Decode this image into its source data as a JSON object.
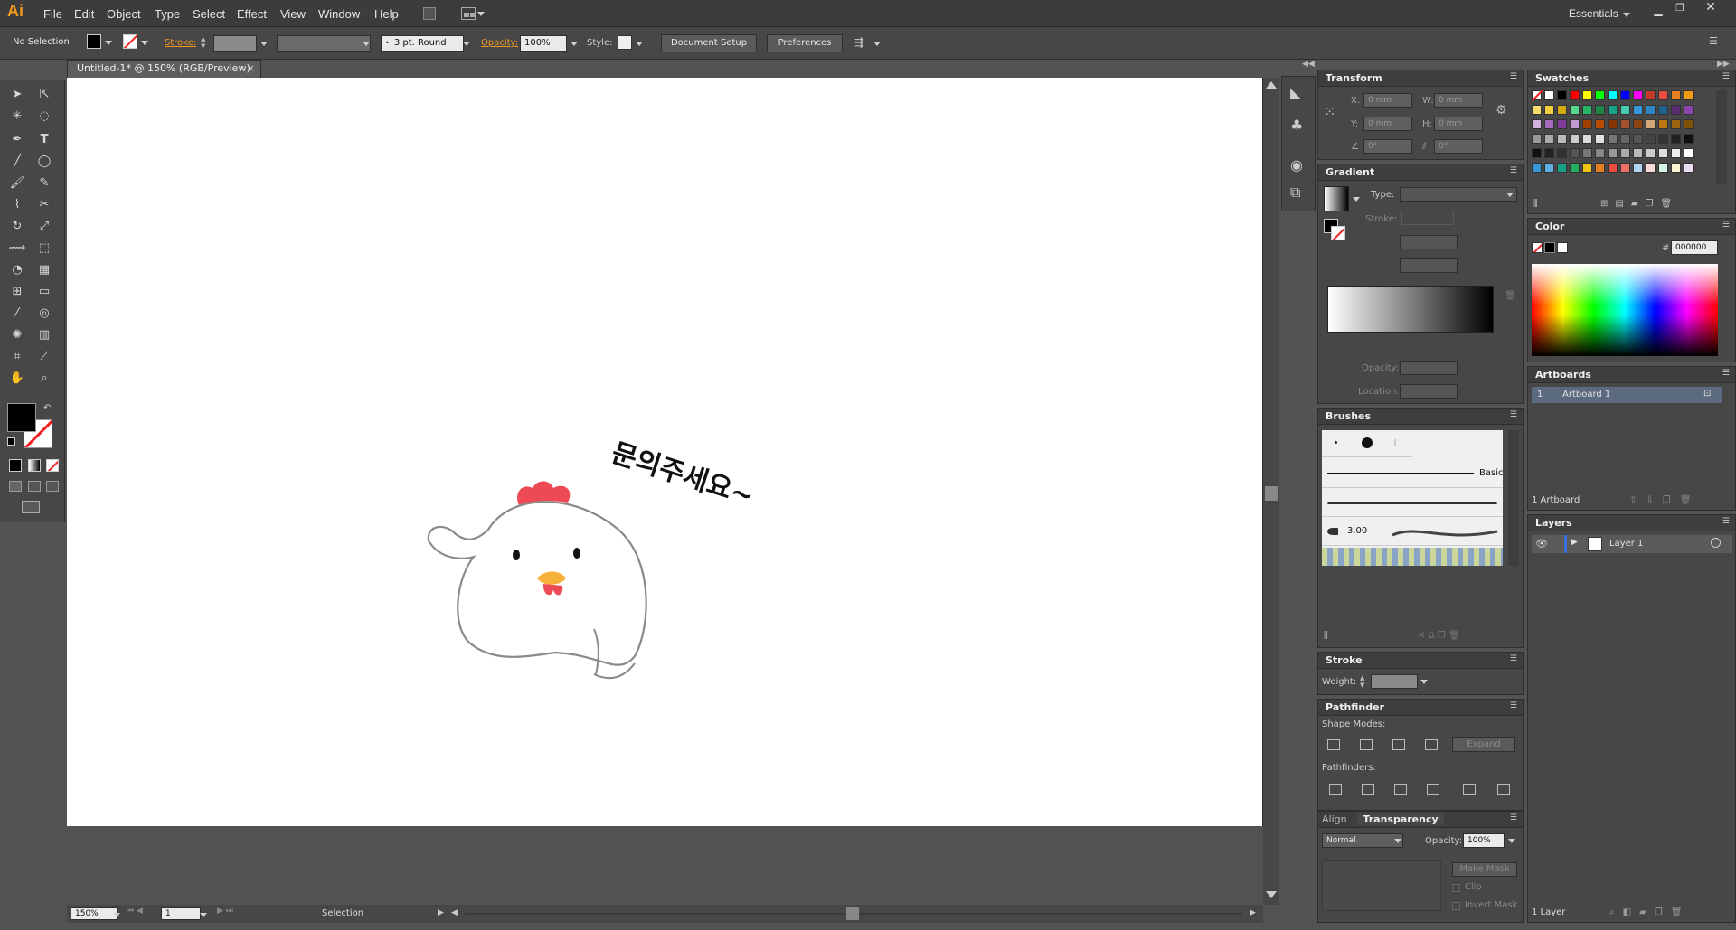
{
  "app": {
    "logo": "Ai",
    "workspace": "Essentials"
  },
  "menu": [
    "File",
    "Edit",
    "Object",
    "Type",
    "Select",
    "Effect",
    "View",
    "Window",
    "Help"
  ],
  "control": {
    "selection": "No Selection",
    "stroke_label": "Stroke:",
    "brush_value": "3 pt. Round",
    "opacity_label": "Opacity:",
    "opacity_value": "100%",
    "style_label": "Style:",
    "document_setup": "Document Setup",
    "preferences": "Preferences"
  },
  "document": {
    "tab_title": "Untitled-1* @ 150% (RGB/Preview)",
    "close": "×"
  },
  "artwork": {
    "text": "문의주세요~"
  },
  "status": {
    "zoom": "150%",
    "page": "1",
    "tool": "Selection"
  },
  "transform": {
    "title": "Transform",
    "x_label": "X:",
    "y_label": "Y:",
    "w_label": "W:",
    "h_label": "H:",
    "x": "0 mm",
    "y": "0 mm",
    "w": "0 mm",
    "h": "0 mm",
    "angle": "0°",
    "shear": "0°"
  },
  "gradient": {
    "title": "Gradient",
    "type_label": "Type:",
    "stroke_label": "Stroke:",
    "opacity_label": "Opacity:",
    "location_label": "Location:"
  },
  "brushes": {
    "title": "Brushes",
    "basic": "Basic",
    "size": "3.00"
  },
  "stroke": {
    "title": "Stroke",
    "weight_label": "Weight:"
  },
  "pathfinder": {
    "title": "Pathfinder",
    "shape_modes": "Shape Modes:",
    "expand": "Expand",
    "pathfinders": "Pathfinders:"
  },
  "transparency": {
    "align_tab": "Align",
    "title": "Transparency",
    "mode": "Normal",
    "opacity_label": "Opacity:",
    "opacity": "100%",
    "make_mask": "Make Mask",
    "clip": "Clip",
    "invert_mask": "Invert Mask"
  },
  "swatches": {
    "title": "Swatches"
  },
  "color": {
    "title": "Color",
    "hex_symbol": "#",
    "hex": "000000"
  },
  "artboards": {
    "title": "Artboards",
    "row_num": "1",
    "row_name": "Artboard 1",
    "count": "1 Artboard"
  },
  "layers": {
    "title": "Layers",
    "layer_name": "Layer 1",
    "count": "1 Layer"
  }
}
